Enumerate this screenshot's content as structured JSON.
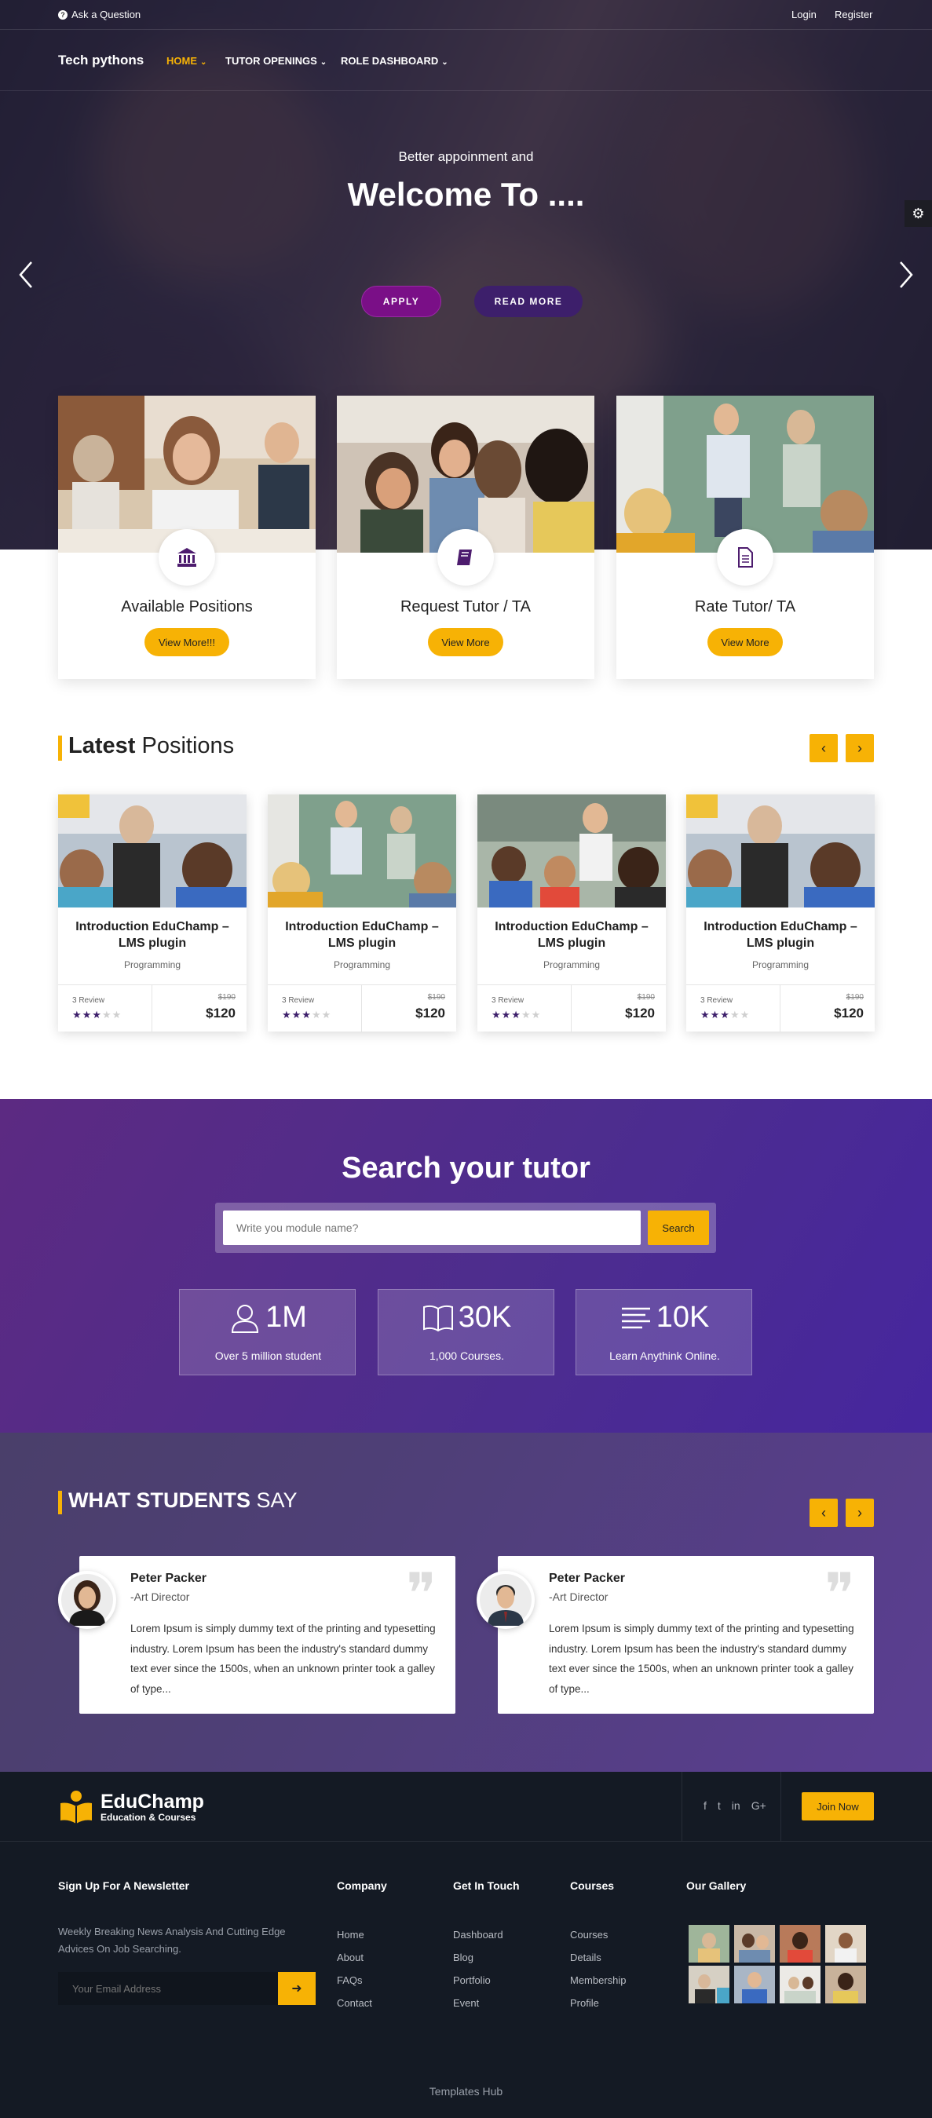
{
  "topbar": {
    "ask": "Ask a Question",
    "login": "Login",
    "register": "Register"
  },
  "nav": {
    "logo": "Tech pythons",
    "items": [
      {
        "label": "HOME"
      },
      {
        "label": "TUTOR OPENINGS"
      },
      {
        "label": "ROLE DASHBOARD"
      }
    ]
  },
  "hero": {
    "subtitle": "Better appoinment and",
    "title": "Welcome To ....",
    "apply": "APPLY",
    "read_more": "READ MORE"
  },
  "features": [
    {
      "title": "Available Positions",
      "button": "View More!!!",
      "icon": "bank-icon"
    },
    {
      "title": "Request Tutor / TA",
      "button": "View More",
      "icon": "book-icon"
    },
    {
      "title": "Rate Tutor/ TA",
      "button": "View More",
      "icon": "document-icon"
    }
  ],
  "latest": {
    "heading_bold": "Latest",
    "heading_rest": " Positions",
    "courses": [
      {
        "title": "Introduction EduChamp – LMS plugin",
        "category": "Programming",
        "reviews": "3 Review",
        "rating": 3,
        "old_price": "$190",
        "price": "$120"
      },
      {
        "title": "Introduction EduChamp – LMS plugin",
        "category": "Programming",
        "reviews": "3 Review",
        "rating": 3,
        "old_price": "$190",
        "price": "$120"
      },
      {
        "title": "Introduction EduChamp – LMS plugin",
        "category": "Programming",
        "reviews": "3 Review",
        "rating": 3,
        "old_price": "$190",
        "price": "$120"
      },
      {
        "title": "Introduction EduChamp – LMS plugin",
        "category": "Programming",
        "reviews": "3 Review",
        "rating": 3,
        "old_price": "$190",
        "price": "$120"
      }
    ]
  },
  "search": {
    "title": "Search your tutor",
    "placeholder": "Write you module name?",
    "button": "Search",
    "stats": [
      {
        "number": "1M",
        "label": "Over 5 million student",
        "icon": "user-icon"
      },
      {
        "number": "30K",
        "label": "1,000 Courses.",
        "icon": "open-book-icon"
      },
      {
        "number": "10K",
        "label": "Learn Anythink Online.",
        "icon": "lines-icon"
      }
    ]
  },
  "testimonials": {
    "heading_bold": "WHAT STUDENTS",
    "heading_rest": " SAY",
    "items": [
      {
        "name": "Peter Packer",
        "role": "-Art Director",
        "text": "Lorem Ipsum is simply dummy text of the printing and typesetting industry. Lorem Ipsum has been the industry's standard dummy text ever since the 1500s, when an unknown printer took a galley of type..."
      },
      {
        "name": "Peter Packer",
        "role": "-Art Director",
        "text": "Lorem Ipsum is simply dummy text of the printing and typesetting industry. Lorem Ipsum has been the industry's standard dummy text ever since the 1500s, when an unknown printer took a galley of type..."
      }
    ]
  },
  "footer": {
    "brand": "EduChamp",
    "brand_sub": "Education & Courses",
    "social": [
      "f",
      "t",
      "in",
      "G+"
    ],
    "join": "Join Now",
    "newsletter_title": "Sign Up For A Newsletter",
    "newsletter_text": "Weekly Breaking News Analysis And Cutting Edge Advices On Job Searching.",
    "email_placeholder": "Your Email Address",
    "columns": [
      {
        "title": "Company",
        "links": [
          "Home",
          "About",
          "FAQs",
          "Contact"
        ]
      },
      {
        "title": "Get In Touch",
        "links": [
          "Dashboard",
          "Blog",
          "Portfolio",
          "Event"
        ]
      },
      {
        "title": "Courses",
        "links": [
          "Courses",
          "Details",
          "Membership",
          "Profile"
        ]
      }
    ],
    "gallery_title": "Our Gallery",
    "copyright": "Templates Hub"
  },
  "colors": {
    "accent": "#f7b205",
    "purple": "#4d2d8e",
    "apply": "#7a0f87",
    "readmore": "#3d1f6b",
    "footer": "#141a24"
  }
}
